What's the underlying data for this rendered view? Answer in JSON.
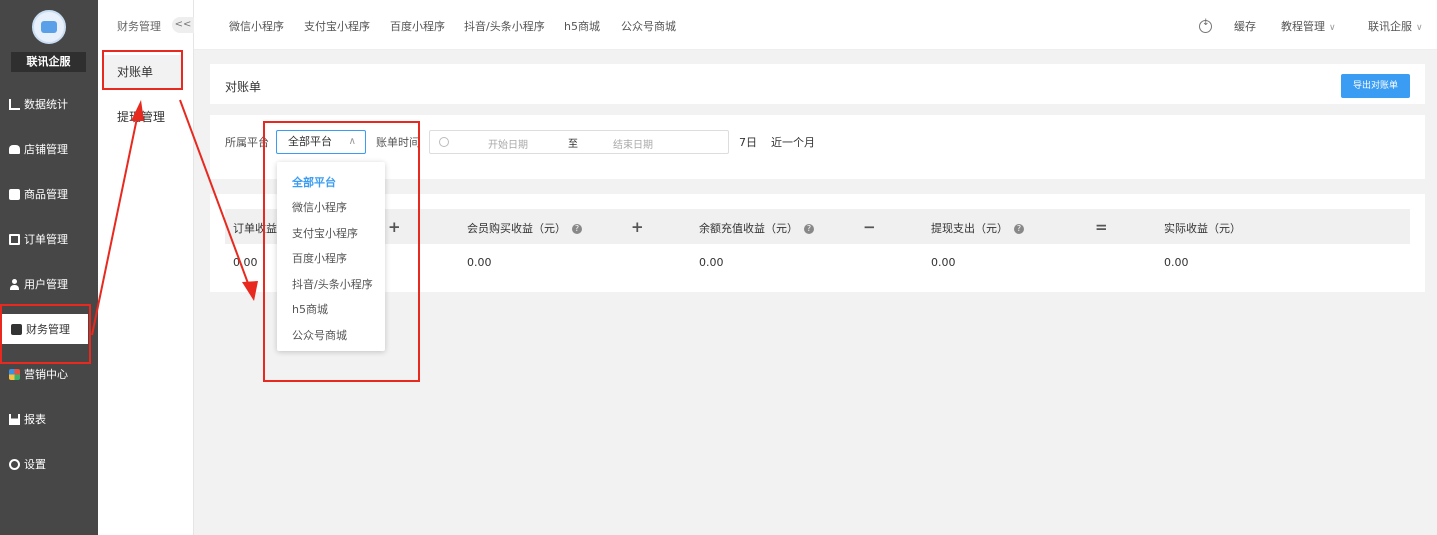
{
  "sidebar": {
    "brand": "联讯企服",
    "items": [
      {
        "label": "数据统计",
        "icon": "chart-icon"
      },
      {
        "label": "店铺管理",
        "icon": "shop-icon"
      },
      {
        "label": "商品管理",
        "icon": "goods-icon"
      },
      {
        "label": "订单管理",
        "icon": "order-icon"
      },
      {
        "label": "用户管理",
        "icon": "user-icon"
      },
      {
        "label": "财务管理",
        "icon": "finance-icon"
      },
      {
        "label": "营销中心",
        "icon": "marketing-icon"
      },
      {
        "label": "报表",
        "icon": "report-icon"
      },
      {
        "label": "设置",
        "icon": "settings-icon"
      }
    ]
  },
  "submenu": {
    "title": "财务管理",
    "collapse": "<<",
    "items": [
      "对账单",
      "提现管理"
    ]
  },
  "topbar": {
    "tabs": [
      "微信小程序",
      "支付宝小程序",
      "百度小程序",
      "抖音/头条小程序",
      "h5商城",
      "公众号商城"
    ],
    "cache": "缓存",
    "tutorial": "教程管理",
    "account": "联讯企服"
  },
  "page": {
    "title": "对账单",
    "export_label": "导出对账单"
  },
  "filters": {
    "platform_label": "所属平台",
    "platform_value": "全部平台",
    "time_label": "账单时间",
    "start_placeholder": "开始日期",
    "separator": "至",
    "end_placeholder": "结束日期",
    "quick_7": "7日",
    "quick_month": "近一个月"
  },
  "dropdown": {
    "options": [
      "全部平台",
      "微信小程序",
      "支付宝小程序",
      "百度小程序",
      "抖音/头条小程序",
      "h5商城",
      "公众号商城"
    ],
    "selected": "全部平台"
  },
  "stats": {
    "headers": [
      "订单收益",
      "会员购买收益（元）",
      "余额充值收益（元）",
      "提现支出（元）",
      "实际收益（元）"
    ],
    "operators": [
      "+",
      "+",
      "−",
      "="
    ],
    "values": [
      "0.00",
      "0.00",
      "0.00",
      "0.00",
      "0.00"
    ]
  },
  "colors": {
    "sidebar_bg": "#474747",
    "accent": "#3a9cf2",
    "annotation_red": "#e8291f"
  }
}
